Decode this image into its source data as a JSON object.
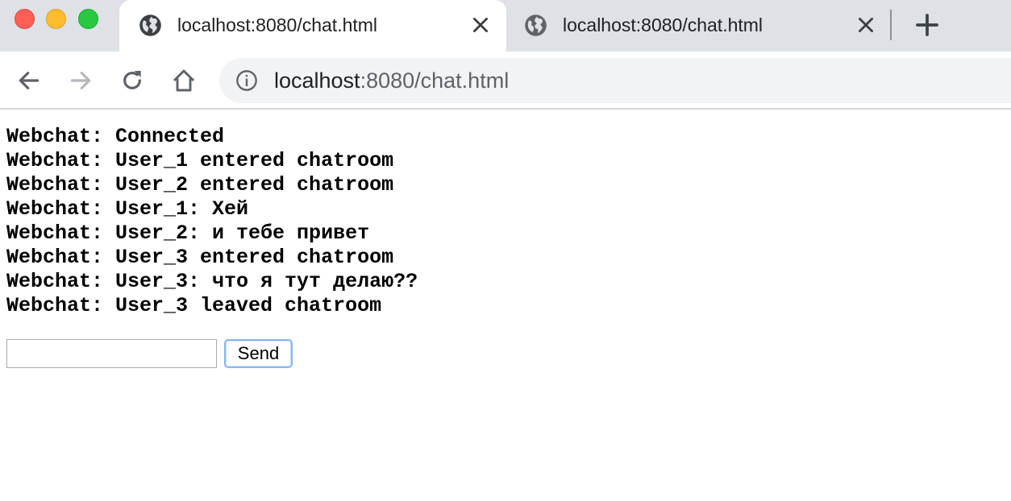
{
  "browser": {
    "tabs": [
      {
        "title": "localhost:8080/chat.html",
        "active": true,
        "favicon": "globe-icon"
      },
      {
        "title": "localhost:8080/chat.html",
        "active": false,
        "favicon": "globe-icon"
      }
    ],
    "address_bar": {
      "host": "localhost",
      "rest": ":8080/chat.html",
      "icon": "info-icon"
    },
    "nav_icons": [
      "back-arrow-icon",
      "forward-arrow-icon",
      "reload-icon",
      "home-icon"
    ],
    "colors": {
      "traffic_close": "#ff5f57",
      "traffic_minimize": "#febc2e",
      "traffic_maximize": "#28c840"
    }
  },
  "chat": {
    "messages": [
      "Webchat: Connected",
      "Webchat: User_1 entered chatroom",
      "Webchat: User_2 entered chatroom",
      "Webchat: User_1: Хей",
      "Webchat: User_2: и тебе привет",
      "Webchat: User_3 entered chatroom",
      "Webchat: User_3: что я тут делаю??",
      "Webchat: User_3 leaved chatroom"
    ],
    "input_value": "",
    "send_label": "Send"
  }
}
